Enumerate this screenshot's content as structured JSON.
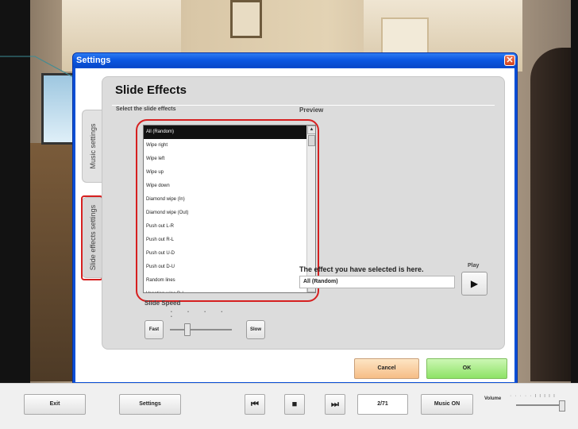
{
  "dialog": {
    "title": "Settings",
    "close_icon": "close-icon"
  },
  "tabs": {
    "music": "Music settings",
    "slide": "Slide effects settings"
  },
  "panel": {
    "heading": "Slide Effects",
    "select_label": "Select the slide effects",
    "preview_label": "Preview"
  },
  "effects": {
    "items": [
      "All (Random)",
      "Wipe right",
      "Wipe left",
      "Wipe up",
      "Wipe down",
      "Diamond wipe (In)",
      "Diamond wipe (Out)",
      "Push out L-R",
      "Push out R-L",
      "Push out U-D",
      "Push out D-U",
      "Random lines",
      "Venetian wipe D-L"
    ],
    "selected_index": 0
  },
  "selection": {
    "label": "The effect you have selected is here.",
    "value": "All (Random)",
    "play_label": "Play",
    "play_icon": "play-icon"
  },
  "speed": {
    "label": "Slide Speed",
    "fast": "Fast",
    "slow": "Slow",
    "ticks": "• • • • •",
    "level": 0.25
  },
  "actions": {
    "cancel": "Cancel",
    "ok": "OK"
  },
  "bottom": {
    "exit": "Exit",
    "settings": "Settings",
    "prev_icon": "skip-previous-icon",
    "stop_icon": "stop-icon",
    "next_icon": "skip-next-icon",
    "counter": "2/71",
    "music": "Music ON",
    "volume_label": "Volume",
    "volume_ticks": "· · · · · ı ı ı ı ı",
    "volume_level": 1.0
  },
  "colors": {
    "titlebar": "#0a56e0",
    "highlight": "#d62020",
    "cancel": "#f6bd86",
    "ok": "#8de266"
  }
}
